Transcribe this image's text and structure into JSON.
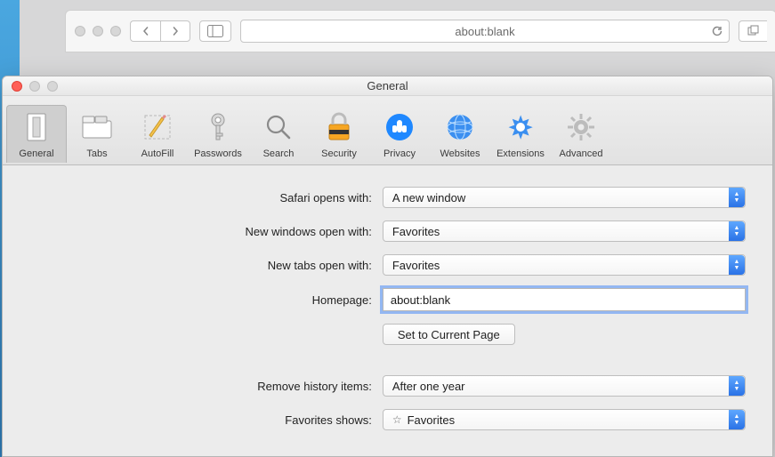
{
  "browser": {
    "url": "about:blank"
  },
  "prefs": {
    "title": "General",
    "tabs": {
      "general": "General",
      "tabs": "Tabs",
      "autofill": "AutoFill",
      "passwords": "Passwords",
      "search": "Search",
      "security": "Security",
      "privacy": "Privacy",
      "websites": "Websites",
      "extensions": "Extensions",
      "advanced": "Advanced"
    },
    "labels": {
      "opens_with": "Safari opens with:",
      "new_windows": "New windows open with:",
      "new_tabs": "New tabs open with:",
      "homepage": "Homepage:",
      "set_current": "Set to Current Page",
      "remove_history": "Remove history items:",
      "favorites_shows": "Favorites shows:"
    },
    "values": {
      "opens_with": "A new window",
      "new_windows": "Favorites",
      "new_tabs": "Favorites",
      "homepage": "about:blank",
      "remove_history": "After one year",
      "favorites_shows": "Favorites"
    }
  }
}
